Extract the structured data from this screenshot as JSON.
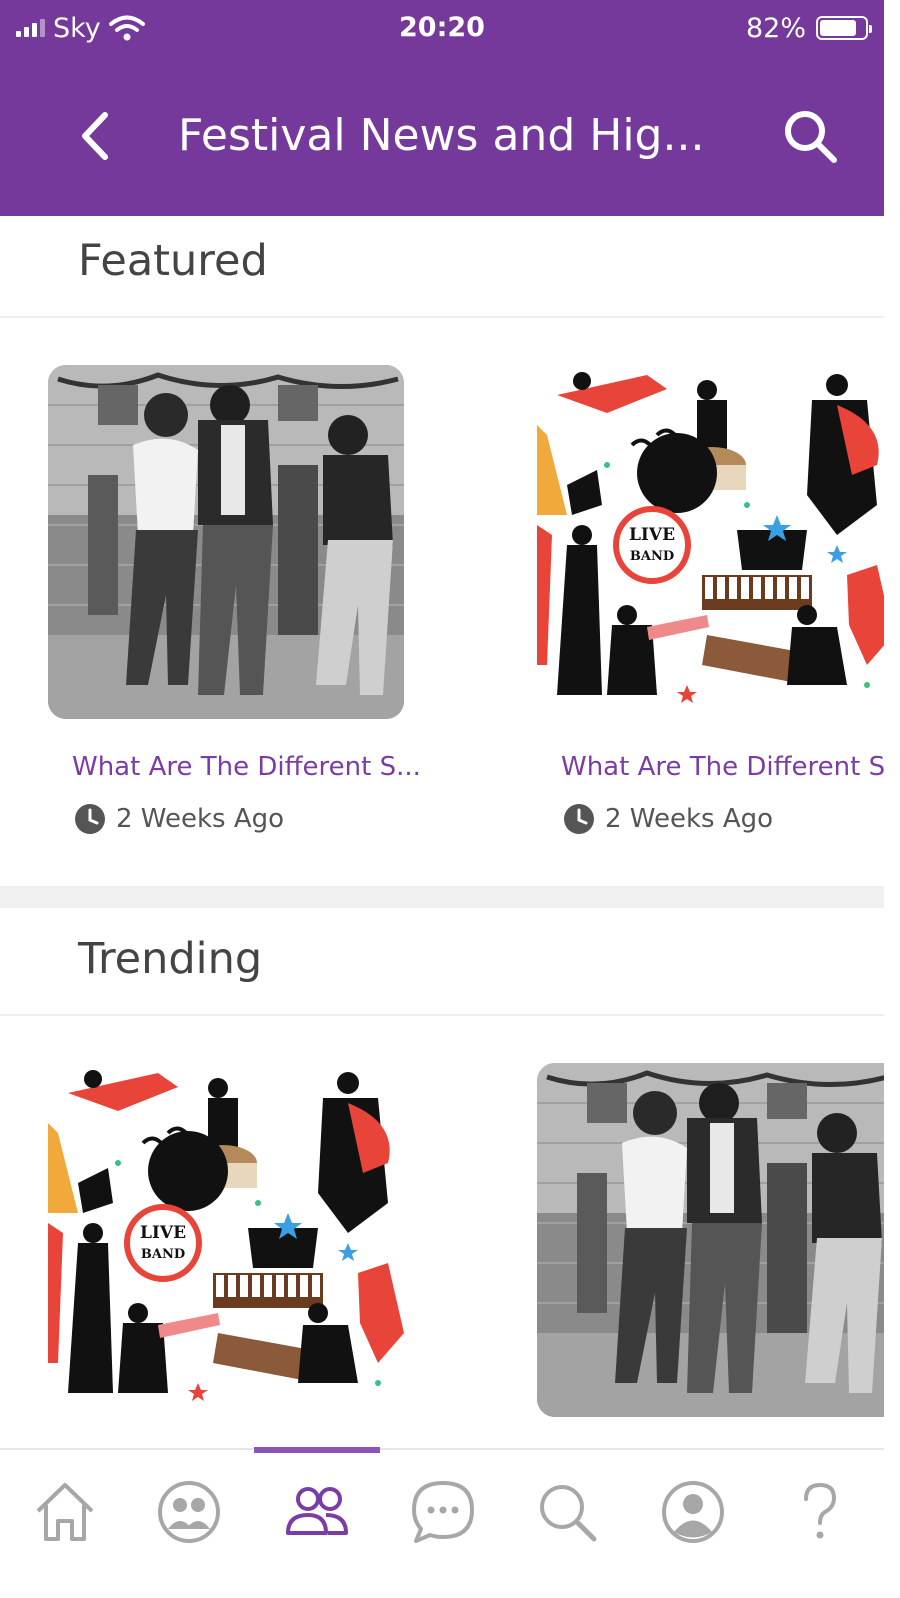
{
  "status_bar": {
    "carrier": "Sky",
    "time": "20:20",
    "battery": "82%",
    "battery_level": 0.82
  },
  "header": {
    "back_icon": "chevron-left-icon",
    "title": "Festival News and Hig...",
    "search_icon": "search-icon"
  },
  "sections": {
    "featured": {
      "title": "Featured",
      "cards": [
        {
          "title": "What Are The Different S...",
          "time": "2 Weeks Ago",
          "image": "vintage-dancers-photo"
        },
        {
          "title": "What Are The Different S...",
          "time": "2 Weeks Ago",
          "image": "live-band-illustration"
        }
      ]
    },
    "trending": {
      "title": "Trending",
      "cards": [
        {
          "image": "live-band-illustration"
        },
        {
          "image": "vintage-dancers-photo"
        }
      ]
    }
  },
  "tab_bar": {
    "tabs": [
      {
        "icon": "home-icon",
        "active": false
      },
      {
        "icon": "community-icon",
        "active": false
      },
      {
        "icon": "groups-icon",
        "active": true
      },
      {
        "icon": "chat-icon",
        "active": false
      },
      {
        "icon": "search-icon",
        "active": false
      },
      {
        "icon": "profile-icon",
        "active": false
      },
      {
        "icon": "help-icon",
        "active": false
      }
    ]
  },
  "colors": {
    "brand": "#74399a",
    "link": "#7a3ca5",
    "tab_inactive": "#a7a7a7",
    "tab_active": "#7a3ca5"
  }
}
